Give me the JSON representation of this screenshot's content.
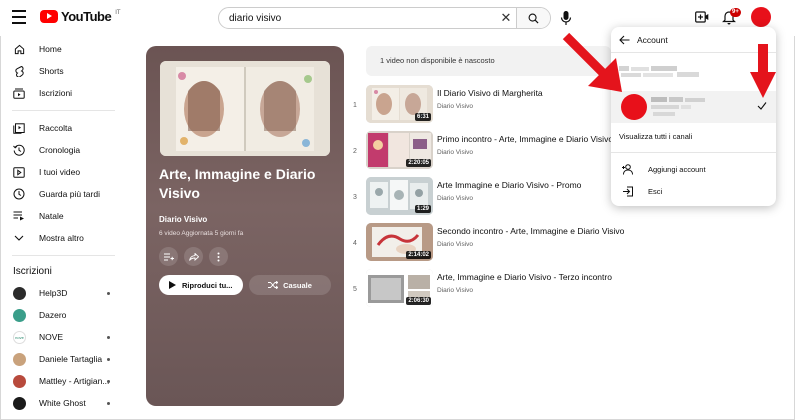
{
  "header": {
    "logo_text": "YouTube",
    "logo_country": "IT",
    "search_value": "diario visivo",
    "notification_badge": "9+"
  },
  "sidebar": {
    "main": [
      {
        "label": "Home",
        "icon": "home-icon"
      },
      {
        "label": "Shorts",
        "icon": "shorts-icon"
      },
      {
        "label": "Iscrizioni",
        "icon": "subscriptions-icon"
      }
    ],
    "library": [
      {
        "label": "Raccolta",
        "icon": "library-icon"
      },
      {
        "label": "Cronologia",
        "icon": "history-icon"
      },
      {
        "label": "I tuoi video",
        "icon": "your-videos-icon"
      },
      {
        "label": "Guarda più tardi",
        "icon": "watch-later-icon"
      },
      {
        "label": "Natale",
        "icon": "playlist-icon"
      },
      {
        "label": "Mostra altro",
        "icon": "chevron-down-icon"
      }
    ],
    "subscriptions_heading": "Iscrizioni",
    "subscriptions": [
      {
        "label": "Help3D",
        "color": "#2b2b2b",
        "dot": true
      },
      {
        "label": "Dazero",
        "color": "#3a9e8a",
        "dot": false
      },
      {
        "label": "NOVE",
        "color": "#ffffff",
        "dot": true
      },
      {
        "label": "Daniele Tartaglia",
        "color": "#c9a27c",
        "dot": true
      },
      {
        "label": "Mattley - Artigian...",
        "color": "#b84a3c",
        "dot": true
      },
      {
        "label": "White Ghost",
        "color": "#1a1a1a",
        "dot": true
      }
    ]
  },
  "playlist": {
    "title": "Arte, Immagine e Diario Visivo",
    "channel": "Diario Visivo",
    "meta": "6 video   Aggiornata 5 giorni fa",
    "play_label": "Riproduci tu...",
    "shuffle_label": "Casuale",
    "notice": "1 video non disponibile è nascosto"
  },
  "videos": [
    {
      "num": "1",
      "title": "Il Diario Visivo di Margherita",
      "channel": "Diario Visivo",
      "duration": "6:31"
    },
    {
      "num": "2",
      "title": "Primo incontro - Arte, Immagine e Diario Visivo",
      "channel": "Diario Visivo",
      "duration": "2:20:05"
    },
    {
      "num": "3",
      "title": "Arte Immagine e Diario Visivo - Promo",
      "channel": "Diario Visivo",
      "duration": "1:29"
    },
    {
      "num": "4",
      "title": "Secondo incontro - Arte, Immagine e Diario Visivo",
      "channel": "Diario Visivo",
      "duration": "2:14:02"
    },
    {
      "num": "5",
      "title": "Arte, Immagine e Diario Visivo - Terzo incontro",
      "channel": "Diario Visivo",
      "duration": "2:06:30"
    }
  ],
  "account_menu": {
    "title": "Account",
    "view_all": "Visualizza tutti i canali",
    "add_account": "Aggiungi account",
    "sign_out": "Esci"
  },
  "colors": {
    "brand_red": "#ff0000",
    "avatar_red": "#e8101a",
    "annotation_arrow": "#e4141c",
    "card_bg": "#755e5d"
  }
}
